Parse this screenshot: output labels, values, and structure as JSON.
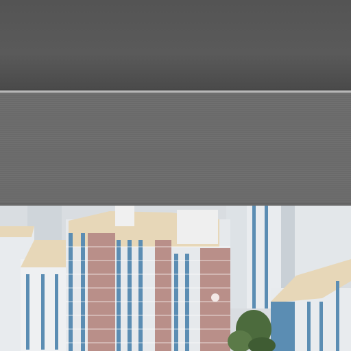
{
  "scene": {
    "description_colors": {
      "panel": "#5a5a5a",
      "sky_haze": "#d9dde1",
      "building_white": "#e9ecef",
      "building_pink": "#b98f89",
      "building_blue": "#5b8db3",
      "roof_tan": "#e7d7b8",
      "tree_green": "#4c6b3d"
    },
    "elements": [
      "window-blind-panels",
      "apartment-towers",
      "trees"
    ]
  }
}
